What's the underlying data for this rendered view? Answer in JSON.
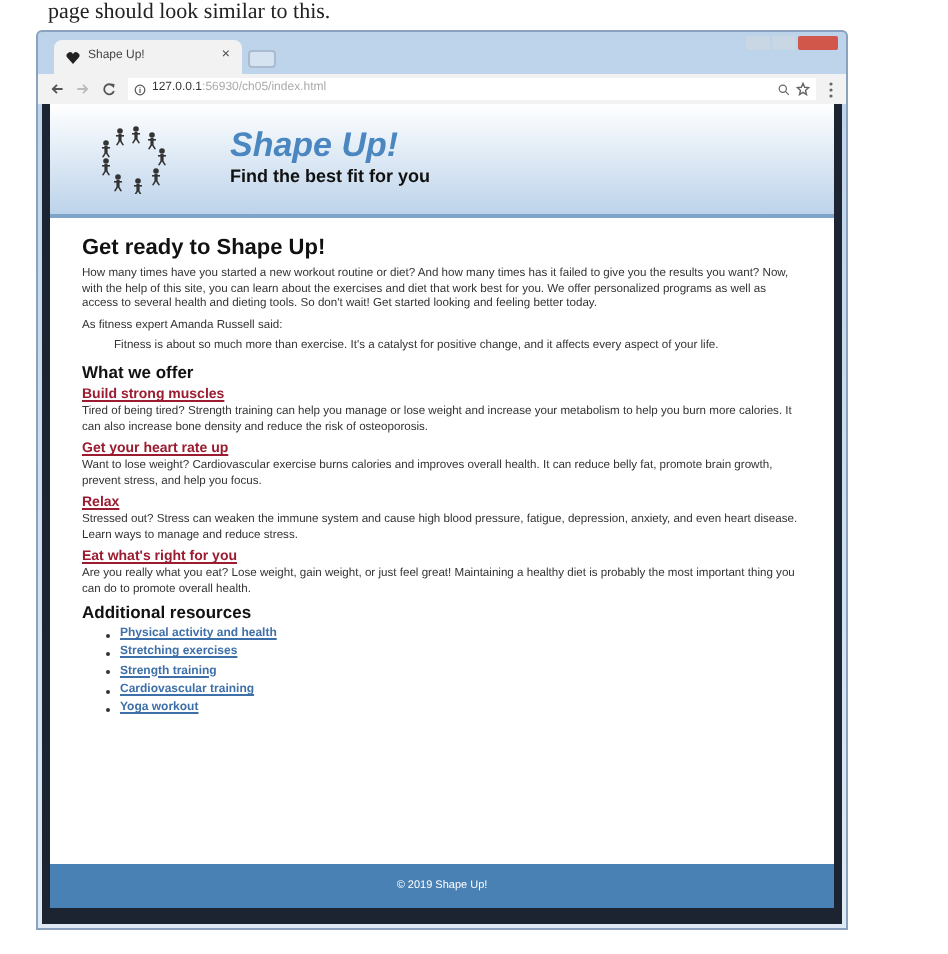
{
  "caption": "page should look similar to this.",
  "browser": {
    "tab_title": "Shape Up!",
    "tab_close": "×",
    "url_host": "127.0.0.1",
    "url_path": ":56930/ch05/index.html"
  },
  "header": {
    "title": "Shape Up!",
    "tagline": "Find the best fit for you"
  },
  "main": {
    "heading": "Get ready to Shape Up!",
    "intro": "How many times have you started a new workout routine or diet? And how many times has it failed to give you the results you want? Now, with the help of this site, you can learn about the exercises and diet that work best for you. We offer personalized programs as well as access to several health and dieting tools. So don't wait! Get started looking and feeling better today.",
    "quote_intro": "As fitness expert Amanda Russell said:",
    "quote": "Fitness is about so much more than exercise. It's a catalyst for positive change, and it affects every aspect of your life.",
    "offer_heading": "What we offer",
    "offers": [
      {
        "title": "Build strong muscles",
        "text": "Tired of being tired? Strength training can help you manage or lose weight and increase your metabolism to help you burn more calories. It can also increase bone density and reduce the risk of osteoporosis."
      },
      {
        "title": "Get your heart rate up",
        "text": "Want to lose weight? Cardiovascular exercise burns calories and improves overall health. It can reduce belly fat, promote brain growth, prevent stress, and help you focus."
      },
      {
        "title": "Relax",
        "text": "Stressed out? Stress can weaken the immune system and cause high blood pressure, fatigue, depression, anxiety, and even heart disease. Learn ways to manage and reduce stress."
      },
      {
        "title": "Eat what's right for you",
        "text": "Are you really what you eat? Lose weight, gain weight, or just feel great! Maintaining a healthy diet is probably the most important thing you can do to promote overall health."
      }
    ],
    "resources_heading": "Additional resources",
    "resources": [
      "Physical activity and health",
      "Stretching exercises",
      "Strength training",
      "Cardiovascular training",
      "Yoga workout"
    ]
  },
  "footer": "© 2019 Shape Up!"
}
